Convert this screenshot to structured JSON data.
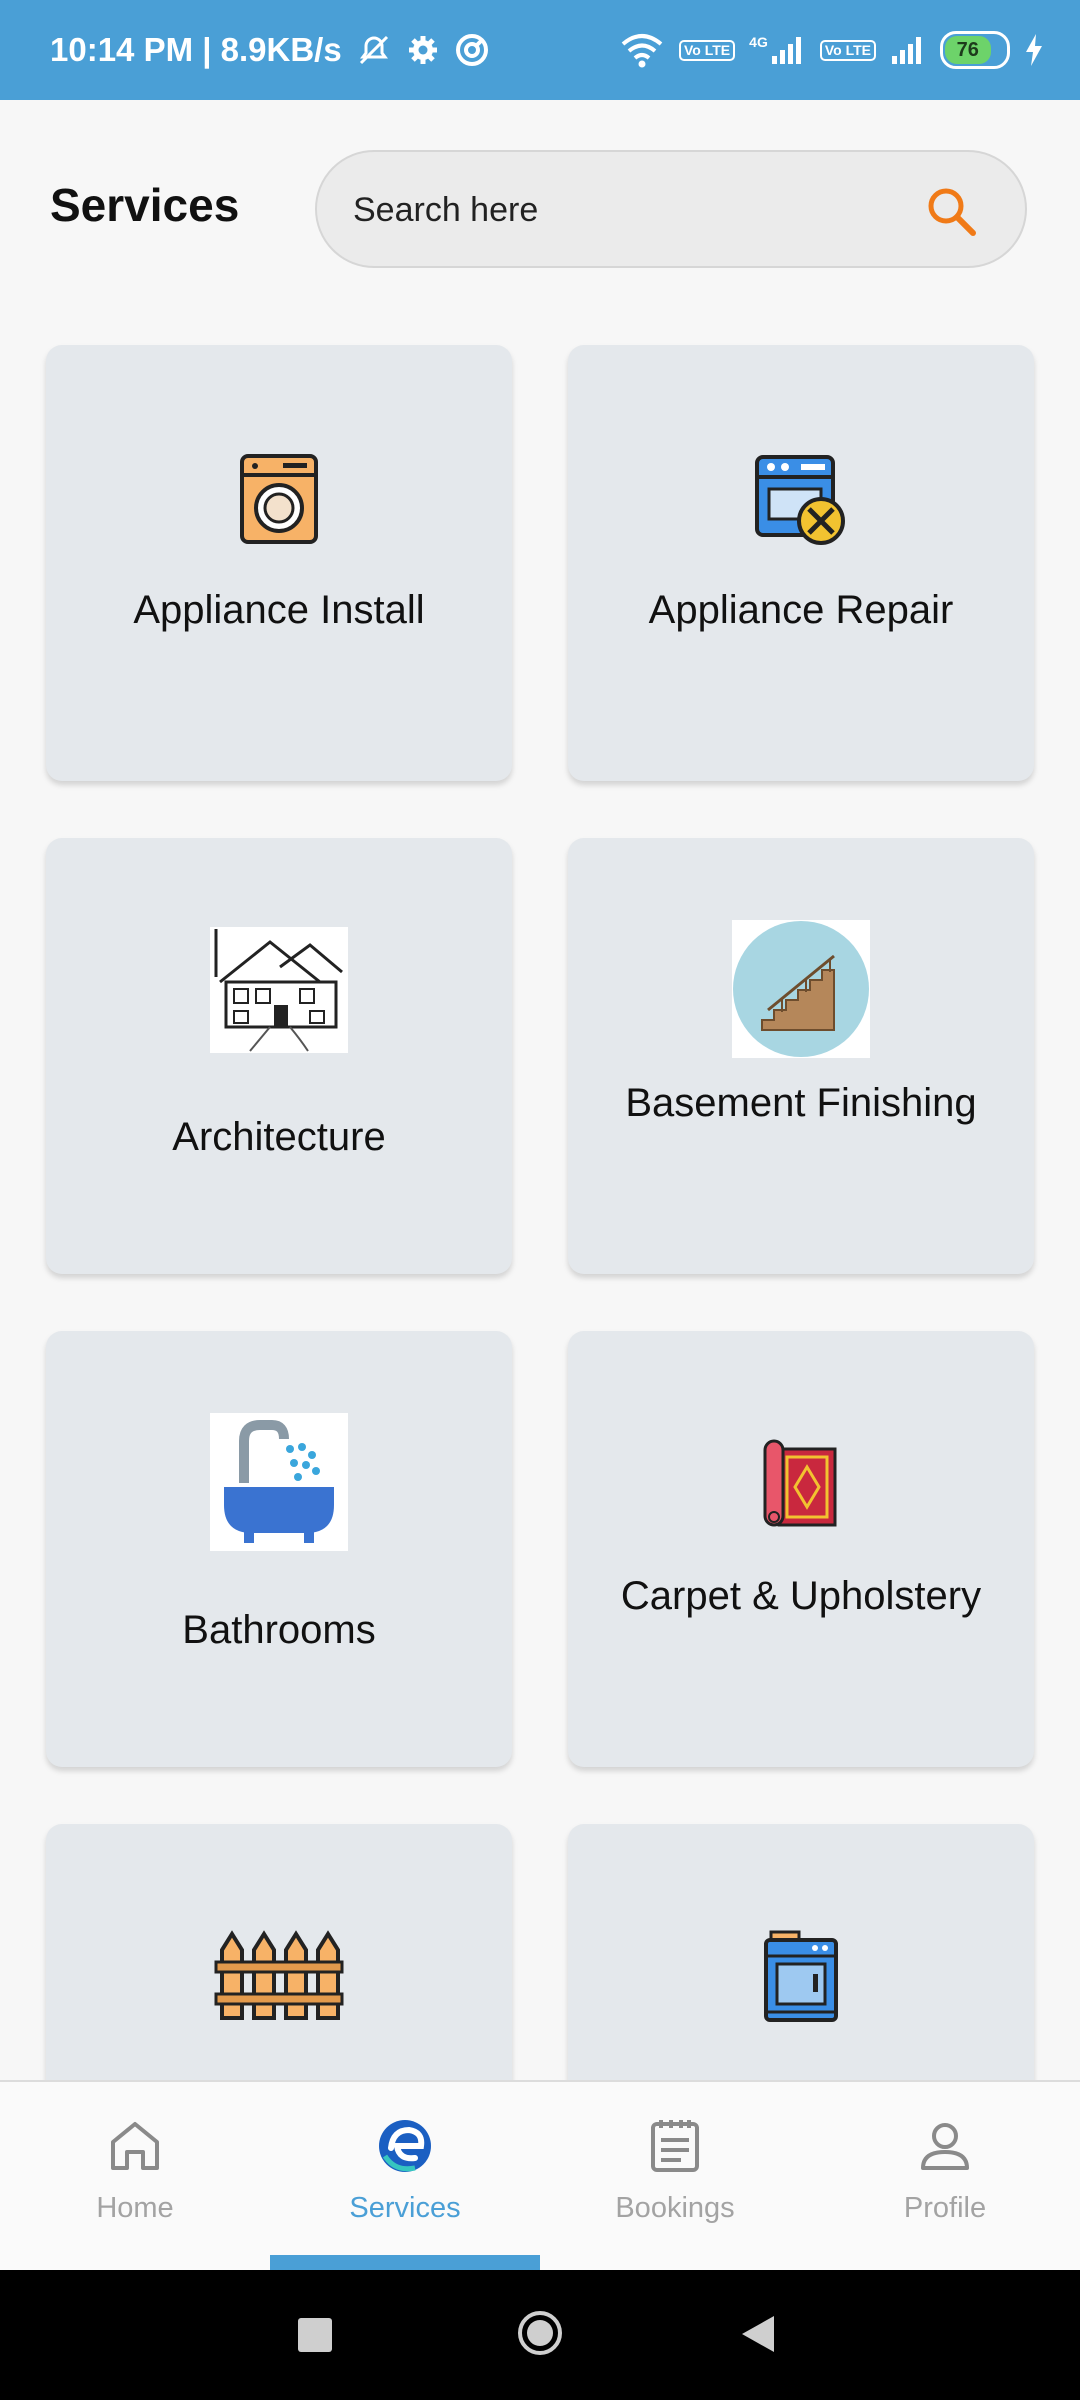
{
  "status_bar": {
    "time_speed": "10:14 PM | 8.9KB/s",
    "network": "4G",
    "volte_label": "Vo LTE",
    "battery": "76"
  },
  "header": {
    "title": "Services",
    "search_placeholder": "Search here"
  },
  "services": [
    {
      "label": "Appliance Install",
      "icon": "washing-machine-icon"
    },
    {
      "label": "Appliance Repair",
      "icon": "appliance-repair-icon"
    },
    {
      "label": "Architecture",
      "icon": "house-sketch-icon"
    },
    {
      "label": "Basement Finishing",
      "icon": "staircase-icon"
    },
    {
      "label": "Bathrooms",
      "icon": "bathtub-shower-icon"
    },
    {
      "label": "Carpet & Upholstery",
      "icon": "carpet-roll-icon"
    },
    {
      "label": "",
      "icon": "fence-icon"
    },
    {
      "label": "",
      "icon": "oven-icon"
    }
  ],
  "bottom_nav": {
    "items": [
      {
        "label": "Home",
        "icon": "home-icon"
      },
      {
        "label": "Services",
        "icon": "services-logo-icon"
      },
      {
        "label": "Bookings",
        "icon": "bookings-icon"
      },
      {
        "label": "Profile",
        "icon": "profile-icon"
      }
    ],
    "active_index": 1
  },
  "colors": {
    "accent": "#4a9fd6",
    "search_icon": "#f07a17",
    "card_bg": "#e4e8ec"
  }
}
